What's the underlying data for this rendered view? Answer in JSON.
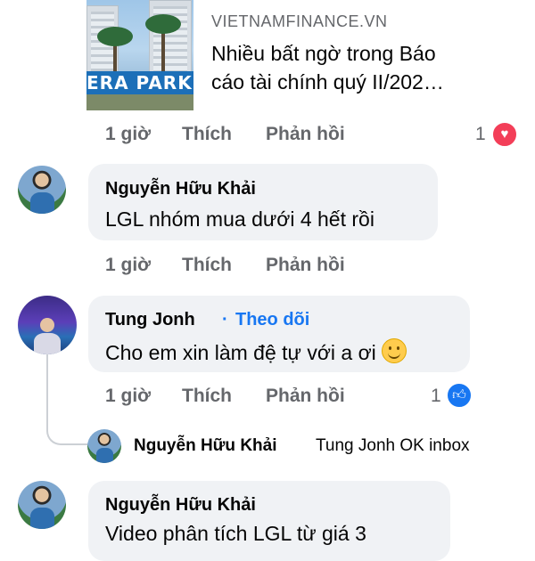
{
  "link_card": {
    "domain": "VIETNAMFINANCE.VN",
    "title": "Nhiều bất ngờ trong Báo cáo tài chính quý II/202…",
    "sign_text": "ERA PARK"
  },
  "actions": {
    "like": "Thích",
    "reply": "Phản hồi"
  },
  "top_actions": {
    "time": "1 giờ",
    "reaction_count": "1"
  },
  "comments": [
    {
      "name": "Nguyễn Hữu Khải",
      "text": "LGL nhóm mua dưới 4 hết rồi",
      "time": "1 giờ"
    },
    {
      "name": "Tung Jonh",
      "follow_label": "Theo dõi",
      "separator": "·",
      "text": "Cho em xin làm đệ tự với a ơi",
      "time": "1 giờ",
      "reaction_count": "1"
    },
    {
      "name": "Nguyễn Hữu Khải",
      "text": "Video phân tích LGL từ giá 3"
    }
  ],
  "reply_preview": {
    "name": "Nguyễn Hữu Khải",
    "text": "Tung Jonh OK inbox"
  },
  "icons": {
    "heart": "heart-reaction-icon",
    "like": "like-reaction-icon",
    "emoji": "smiling-face-emoji"
  },
  "colors": {
    "link": "#1877f2",
    "heart": "#f33e58",
    "like": "#1877f2",
    "bubble": "#f0f2f5",
    "muted": "#65676b"
  }
}
